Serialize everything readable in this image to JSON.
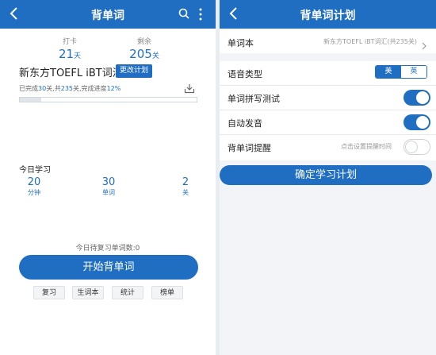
{
  "left_screen": {
    "title": "背单词",
    "stats": {
      "checkin_label": "打卡",
      "checkin_value": "21",
      "checkin_unit": "天",
      "remaining_label": "剩余",
      "remaining_value": "205",
      "remaining_unit": "关"
    },
    "book_title": "新东方TOEFL iBT词汇",
    "change_plan_label": "更改计划",
    "progress": {
      "prefix": "已完成",
      "done": "30",
      "mid": "关,共",
      "total": "235",
      "mid2": "关,完成进度",
      "percent": "12%",
      "fraction": 0.12
    },
    "today": {
      "label": "今日学习",
      "items": [
        {
          "value": "20",
          "unit": "分钟"
        },
        {
          "value": "30",
          "unit": "单词"
        },
        {
          "value": "2",
          "unit": "关"
        }
      ]
    },
    "review_count": "今日待复习单词数:0",
    "start_button": "开始背单词",
    "small_buttons": [
      "复习",
      "生词本",
      "统计",
      "榜单"
    ]
  },
  "right_screen": {
    "title": "背单词计划",
    "wordbook_label": "单词本",
    "wordbook_value": "新东方TOEFL iBT词汇(共235关)",
    "voice_type_label": "语音类型",
    "voice_options": [
      "美",
      "英"
    ],
    "voice_selected": "美",
    "spelling_test_label": "单词拼写测试",
    "spelling_test_on": true,
    "auto_pronounce_label": "自动发音",
    "auto_pronounce_on": true,
    "reminder_label": "背单词提醒",
    "reminder_hint": "点击设置提醒时间",
    "reminder_on": false,
    "confirm_button": "确定学习计划"
  },
  "colors": {
    "brand": "#1f6ec2",
    "background_right": "#f2f4f7"
  },
  "icons": [
    "back-icon",
    "search-icon",
    "more-icon",
    "download-icon",
    "chevron-right-icon"
  ]
}
